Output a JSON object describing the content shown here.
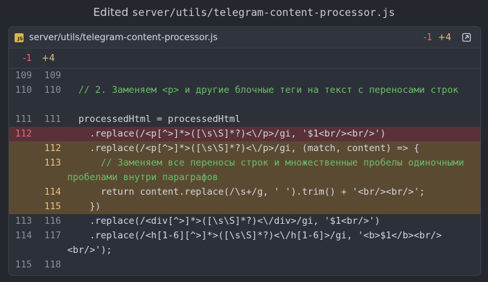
{
  "title": {
    "prefix": "Edited",
    "path": "server/utils/telegram-content-processor.js"
  },
  "file": {
    "icon": "js-file-icon",
    "icon_label": "JS",
    "path": "server/utils/telegram-content-processor.js",
    "deletions": "-1",
    "additions": "+4"
  },
  "summary": {
    "deletions": "-1",
    "additions": "+4"
  },
  "lines": [
    {
      "old": "109",
      "new": "109",
      "type": "ctx",
      "text": ""
    },
    {
      "old": "110",
      "new": "110",
      "type": "ctx",
      "text": "  // 2. Заменяем <p> и другие блочные теги на текст с переносами строк"
    },
    {
      "old": "111",
      "new": "111",
      "type": "ctx",
      "text": "  processedHtml = processedHtml"
    },
    {
      "old": "112",
      "new": "",
      "type": "del",
      "text": "    .replace(/<p[^>]*>([\\s\\S]*?)<\\/p>/gi, '$1<br/><br/>')"
    },
    {
      "old": "",
      "new": "112",
      "type": "add",
      "text": "    .replace(/<p[^>]*>([\\s\\S]*?)<\\/p>/gi, (match, content) => {"
    },
    {
      "old": "",
      "new": "113",
      "type": "add",
      "text": "      // Заменяем все переносы строк и множественные пробелы одиночными пробелами внутри параграфов"
    },
    {
      "old": "",
      "new": "114",
      "type": "add",
      "text": "      return content.replace(/\\s+/g, ' ').trim() + '<br/><br/>';"
    },
    {
      "old": "",
      "new": "115",
      "type": "add",
      "text": "    })"
    },
    {
      "old": "113",
      "new": "116",
      "type": "ctx",
      "text": "    .replace(/<div[^>]*>([\\s\\S]*?)<\\/div>/gi, '$1<br/>')"
    },
    {
      "old": "114",
      "new": "117",
      "type": "ctx",
      "text": "    .replace(/<h[1-6][^>]*>([\\s\\S]*?)<\\/h[1-6]>/gi, '<b>$1</b><br/><br/>');"
    },
    {
      "old": "115",
      "new": "118",
      "type": "ctx",
      "text": ""
    }
  ],
  "colors": {
    "deleted_row": "#5a3039",
    "added_row": "#5a4a32",
    "comment": "#6bbf6b",
    "regex": "#d58ad4"
  }
}
